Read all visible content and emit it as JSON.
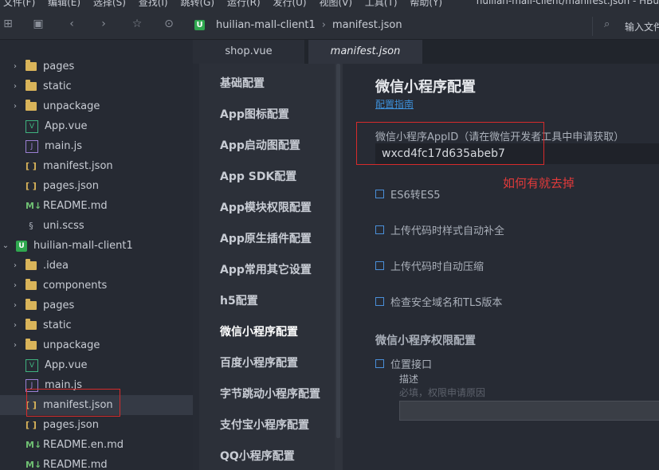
{
  "menubar": {
    "items": [
      "文件(F)",
      "编辑(E)",
      "选择(S)",
      "查找(I)",
      "跳转(G)",
      "运行(R)",
      "发行(U)",
      "视图(V)",
      "工具(T)",
      "帮助(Y)"
    ],
    "window_title": "huilian-mall-client/manifest.json - HBu"
  },
  "toolbar": {
    "breadcrumb_project": "huilian-mall-client1",
    "breadcrumb_file": "manifest.json",
    "search_label": "输入文件"
  },
  "sidebar": {
    "items": [
      {
        "label": "pages",
        "type": "folder",
        "expandable": true
      },
      {
        "label": "static",
        "type": "folder",
        "expandable": true
      },
      {
        "label": "unpackage",
        "type": "folder",
        "expandable": true
      },
      {
        "label": "App.vue",
        "type": "vue"
      },
      {
        "label": "main.js",
        "type": "js"
      },
      {
        "label": "manifest.json",
        "type": "json"
      },
      {
        "label": "pages.json",
        "type": "json"
      },
      {
        "label": "README.md",
        "type": "md"
      },
      {
        "label": "uni.scss",
        "type": "scss"
      },
      {
        "label": "huilian-mall-client1",
        "type": "project",
        "expanded": true
      },
      {
        "label": ".idea",
        "type": "folder",
        "expandable": true
      },
      {
        "label": "components",
        "type": "folder",
        "expandable": true
      },
      {
        "label": "pages",
        "type": "folder",
        "expandable": true
      },
      {
        "label": "static",
        "type": "folder",
        "expandable": true
      },
      {
        "label": "unpackage",
        "type": "folder",
        "expandable": true
      },
      {
        "label": "App.vue",
        "type": "vue"
      },
      {
        "label": "main.js",
        "type": "js"
      },
      {
        "label": "manifest.json",
        "type": "json",
        "selected": true
      },
      {
        "label": "pages.json",
        "type": "json"
      },
      {
        "label": "README.en.md",
        "type": "md"
      },
      {
        "label": "README.md",
        "type": "md"
      }
    ]
  },
  "tabs": [
    {
      "label": "shop.vue"
    },
    {
      "label": "manifest.json",
      "active": true
    }
  ],
  "settings_nav": [
    {
      "label": "基础配置"
    },
    {
      "label": "App图标配置"
    },
    {
      "label": "App启动图配置"
    },
    {
      "label": "App SDK配置"
    },
    {
      "label": "App模块权限配置"
    },
    {
      "label": "App原生插件配置"
    },
    {
      "label": "App常用其它设置"
    },
    {
      "label": "h5配置"
    },
    {
      "label": "微信小程序配置",
      "active": true
    },
    {
      "label": "百度小程序配置"
    },
    {
      "label": "字节跳动小程序配置"
    },
    {
      "label": "支付宝小程序配置"
    },
    {
      "label": "QQ小程序配置"
    }
  ],
  "main": {
    "title": "微信小程序配置",
    "guide_link": "配置指南",
    "appid_label": "微信小程序AppID（请在微信开发者工具中申请获取）",
    "appid_value": "wxcd4fc17d635abeb7",
    "annotation": "如何有就去掉",
    "checkboxes": [
      {
        "label": "ES6转ES5",
        "checked": false
      },
      {
        "label": "上传代码时样式自动补全",
        "checked": false
      },
      {
        "label": "上传代码时自动压缩",
        "checked": false
      },
      {
        "label": "检查安全域名和TLS版本",
        "checked": false
      }
    ],
    "permission_title": "微信小程序权限配置",
    "location_label": "位置接口",
    "desc_label": "描述",
    "desc_placeholder": "必填，权限申请原因"
  },
  "colors": {
    "accent_link": "#3d8fd8",
    "annotation_red": "#d62b2b",
    "checkbox_blue": "#4a8fd9"
  }
}
